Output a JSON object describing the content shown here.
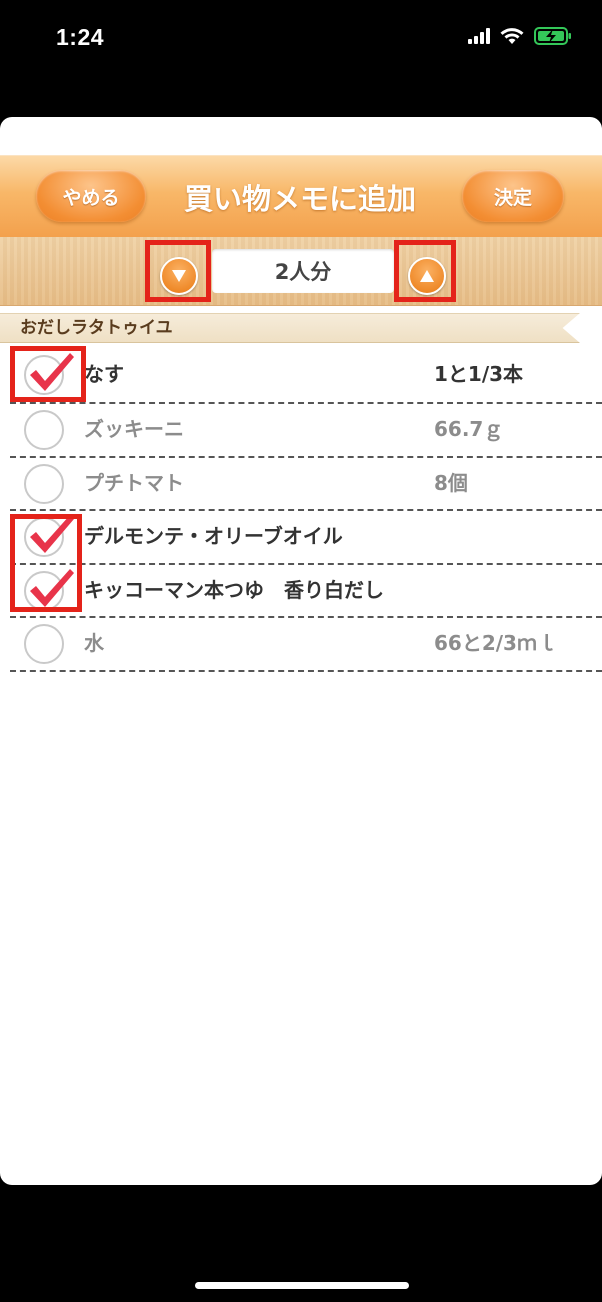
{
  "status_bar": {
    "time": "1:24",
    "icons": [
      "signal-icon",
      "wifi-icon",
      "battery-charging-icon"
    ],
    "battery_color": "#34c759"
  },
  "header": {
    "cancel_label": "やめる",
    "title": "買い物メモに追加",
    "confirm_label": "決定"
  },
  "servings": {
    "value": "2人分",
    "decrease_icon": "triangle-down-icon",
    "increase_icon": "triangle-up-icon"
  },
  "recipe": {
    "name": "おだしラタトゥイユ",
    "ingredients": [
      {
        "name": "なす",
        "quantity": "1と1/3本",
        "checked": true
      },
      {
        "name": "ズッキーニ",
        "quantity": "66.7ｇ",
        "checked": false
      },
      {
        "name": "プチトマト",
        "quantity": "8個",
        "checked": false
      },
      {
        "name": "デルモンテ・オリーブオイル",
        "quantity": "",
        "checked": true
      },
      {
        "name": "キッコーマン本つゆ　香り白だし",
        "quantity": "",
        "checked": true
      },
      {
        "name": "水",
        "quantity": "66と2/3ｍｌ",
        "checked": false
      }
    ]
  },
  "colors": {
    "accent_orange": "#f3a04c",
    "highlight_red": "#e4231a",
    "check_red": "#e8344a"
  }
}
